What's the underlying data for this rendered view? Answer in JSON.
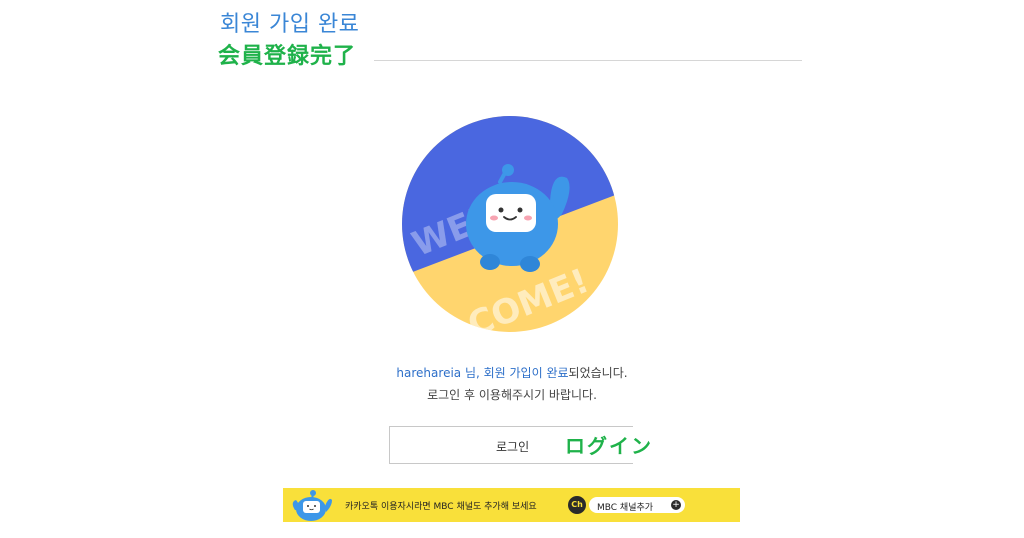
{
  "header": {
    "title_ko": "회원 가입 완료",
    "title_ja": "会員登録完了"
  },
  "welcome_image": {
    "text_top": "WEL—",
    "text_bottom": "COME!",
    "colors": {
      "top": "#4a67e0",
      "bottom": "#ffd56e",
      "mascot": "#3d97e8"
    }
  },
  "message": {
    "username": "harehareia",
    "line1_mid": " 님, ",
    "line1_highlight": "회원 가입이 완료",
    "line1_end": "되었습니다.",
    "line2": "로그인 후 이용해주시기 바랍니다."
  },
  "login": {
    "button_label": "로그인",
    "label_ja": "ログイン"
  },
  "banner": {
    "text": "카카오톡 이용자시라면 MBC 채널도 추가해 보세요",
    "ch_icon": "Ch",
    "channel_button": "MBC 채널추가",
    "plus_icon": "+",
    "background": "#f9e03a"
  }
}
